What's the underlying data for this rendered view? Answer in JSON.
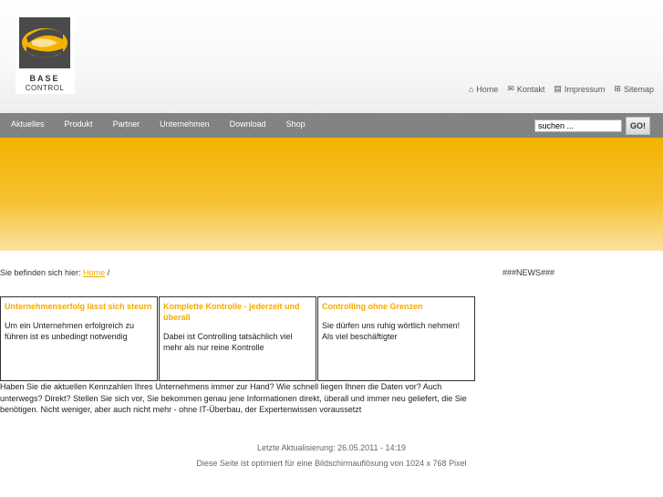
{
  "logo": {
    "text_line1": "BASE",
    "text_line2": "CONTROL"
  },
  "toplinks": [
    {
      "icon": "home-icon",
      "glyph": "⌂",
      "label": "Home"
    },
    {
      "icon": "mail-icon",
      "glyph": "✉",
      "label": "Kontakt"
    },
    {
      "icon": "document-icon",
      "glyph": "▤",
      "label": "Impressum"
    },
    {
      "icon": "sitemap-icon",
      "glyph": "⊞",
      "label": "Sitemap"
    }
  ],
  "nav": [
    "Aktuelles",
    "Produkt",
    "Partner",
    "Unternehmen",
    "Download",
    "Shop"
  ],
  "search": {
    "placeholder": "suchen ...",
    "value": "suchen ...",
    "button": "GO!"
  },
  "breadcrumb": {
    "prefix": "Sie befinden sich hier:",
    "link": "Home",
    "separator": "/"
  },
  "news": "###NEWS###",
  "boxes": [
    {
      "title": "Unternehmenserfolg lässt sich steurn",
      "text": "Um ein Unternehmen erfolgreich zu führen ist es unbedingt notwendig"
    },
    {
      "title": "Komplette Kontrolle - jederzeit und überall",
      "text": "Dabei ist Controlling tatsächlich viel mehr als nur reine Kontrolle"
    },
    {
      "title": "Controlling ohne Grenzen",
      "text": "Sie dürfen uns ruhig wörtlich nehmen! Als viel beschäftigter"
    }
  ],
  "intro": "Haben Sie die aktuellen Kennzahlen Ihres Unternehmens immer zur Hand? Wie schnell liegen Ihnen die Daten vor? Auch unterwegs? Direkt? Stellen Sie sich vor, Sie bekommen genau jene Informationen direkt, überall und immer neu geliefert, die Sie benötigen. Nicht weniger, aber auch nicht mehr - ohne IT-Überbau, der Expertenwissen voraussetzt",
  "footer": {
    "updated": "Letzte Aktualisierung: 26.05.2011 - 14:19",
    "optimized": "Diese Seite ist optimiert für eine Bildschirmauflösung von 1024 x 768 Pixel"
  },
  "colors": {
    "accent": "#f4a900",
    "banner": "#f4b300",
    "navbar": "#7d7d7d",
    "logo_dark": "#4a4a4a",
    "logo_yellow": "#f4b300"
  }
}
